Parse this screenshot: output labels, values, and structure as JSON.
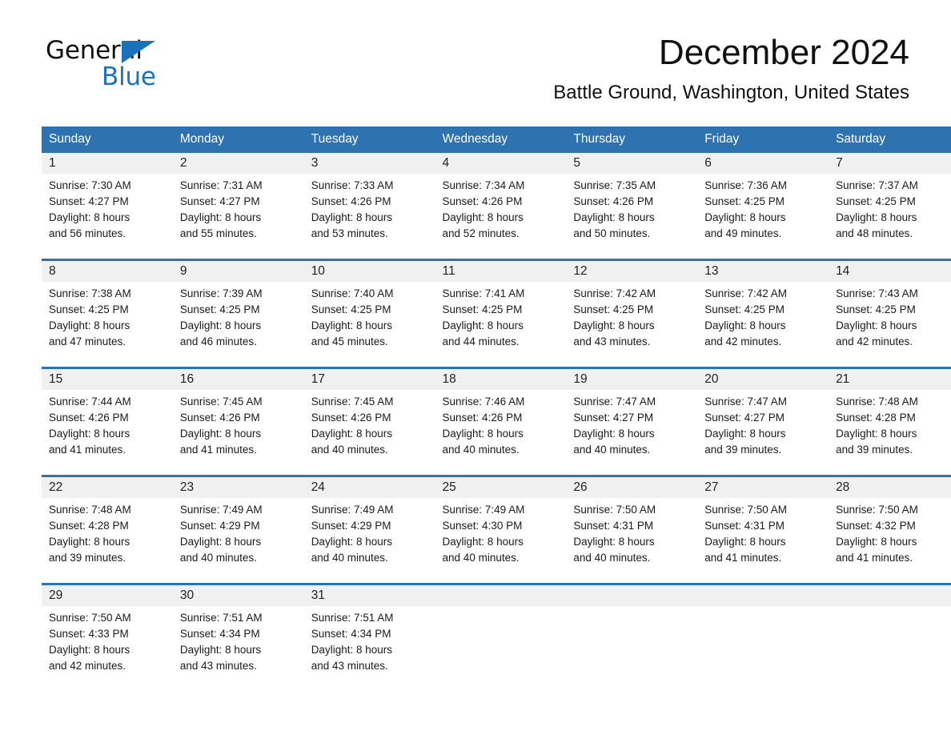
{
  "brand": {
    "name_part1": "General",
    "name_part2": "Blue",
    "accent_color": "#1a72ba"
  },
  "header": {
    "month_title": "December 2024",
    "location": "Battle Ground, Washington, United States"
  },
  "theme": {
    "header_blue": "#2e72b0",
    "day_band_gray": "#f0f0f0"
  },
  "calendar": {
    "weekday_headers": [
      "Sunday",
      "Monday",
      "Tuesday",
      "Wednesday",
      "Thursday",
      "Friday",
      "Saturday"
    ],
    "weeks": [
      [
        {
          "day": "1",
          "sunrise": "Sunrise: 7:30 AM",
          "sunset": "Sunset: 4:27 PM",
          "daylight_line1": "Daylight: 8 hours",
          "daylight_line2": "and 56 minutes."
        },
        {
          "day": "2",
          "sunrise": "Sunrise: 7:31 AM",
          "sunset": "Sunset: 4:27 PM",
          "daylight_line1": "Daylight: 8 hours",
          "daylight_line2": "and 55 minutes."
        },
        {
          "day": "3",
          "sunrise": "Sunrise: 7:33 AM",
          "sunset": "Sunset: 4:26 PM",
          "daylight_line1": "Daylight: 8 hours",
          "daylight_line2": "and 53 minutes."
        },
        {
          "day": "4",
          "sunrise": "Sunrise: 7:34 AM",
          "sunset": "Sunset: 4:26 PM",
          "daylight_line1": "Daylight: 8 hours",
          "daylight_line2": "and 52 minutes."
        },
        {
          "day": "5",
          "sunrise": "Sunrise: 7:35 AM",
          "sunset": "Sunset: 4:26 PM",
          "daylight_line1": "Daylight: 8 hours",
          "daylight_line2": "and 50 minutes."
        },
        {
          "day": "6",
          "sunrise": "Sunrise: 7:36 AM",
          "sunset": "Sunset: 4:25 PM",
          "daylight_line1": "Daylight: 8 hours",
          "daylight_line2": "and 49 minutes."
        },
        {
          "day": "7",
          "sunrise": "Sunrise: 7:37 AM",
          "sunset": "Sunset: 4:25 PM",
          "daylight_line1": "Daylight: 8 hours",
          "daylight_line2": "and 48 minutes."
        }
      ],
      [
        {
          "day": "8",
          "sunrise": "Sunrise: 7:38 AM",
          "sunset": "Sunset: 4:25 PM",
          "daylight_line1": "Daylight: 8 hours",
          "daylight_line2": "and 47 minutes."
        },
        {
          "day": "9",
          "sunrise": "Sunrise: 7:39 AM",
          "sunset": "Sunset: 4:25 PM",
          "daylight_line1": "Daylight: 8 hours",
          "daylight_line2": "and 46 minutes."
        },
        {
          "day": "10",
          "sunrise": "Sunrise: 7:40 AM",
          "sunset": "Sunset: 4:25 PM",
          "daylight_line1": "Daylight: 8 hours",
          "daylight_line2": "and 45 minutes."
        },
        {
          "day": "11",
          "sunrise": "Sunrise: 7:41 AM",
          "sunset": "Sunset: 4:25 PM",
          "daylight_line1": "Daylight: 8 hours",
          "daylight_line2": "and 44 minutes."
        },
        {
          "day": "12",
          "sunrise": "Sunrise: 7:42 AM",
          "sunset": "Sunset: 4:25 PM",
          "daylight_line1": "Daylight: 8 hours",
          "daylight_line2": "and 43 minutes."
        },
        {
          "day": "13",
          "sunrise": "Sunrise: 7:42 AM",
          "sunset": "Sunset: 4:25 PM",
          "daylight_line1": "Daylight: 8 hours",
          "daylight_line2": "and 42 minutes."
        },
        {
          "day": "14",
          "sunrise": "Sunrise: 7:43 AM",
          "sunset": "Sunset: 4:25 PM",
          "daylight_line1": "Daylight: 8 hours",
          "daylight_line2": "and 42 minutes."
        }
      ],
      [
        {
          "day": "15",
          "sunrise": "Sunrise: 7:44 AM",
          "sunset": "Sunset: 4:26 PM",
          "daylight_line1": "Daylight: 8 hours",
          "daylight_line2": "and 41 minutes."
        },
        {
          "day": "16",
          "sunrise": "Sunrise: 7:45 AM",
          "sunset": "Sunset: 4:26 PM",
          "daylight_line1": "Daylight: 8 hours",
          "daylight_line2": "and 41 minutes."
        },
        {
          "day": "17",
          "sunrise": "Sunrise: 7:45 AM",
          "sunset": "Sunset: 4:26 PM",
          "daylight_line1": "Daylight: 8 hours",
          "daylight_line2": "and 40 minutes."
        },
        {
          "day": "18",
          "sunrise": "Sunrise: 7:46 AM",
          "sunset": "Sunset: 4:26 PM",
          "daylight_line1": "Daylight: 8 hours",
          "daylight_line2": "and 40 minutes."
        },
        {
          "day": "19",
          "sunrise": "Sunrise: 7:47 AM",
          "sunset": "Sunset: 4:27 PM",
          "daylight_line1": "Daylight: 8 hours",
          "daylight_line2": "and 40 minutes."
        },
        {
          "day": "20",
          "sunrise": "Sunrise: 7:47 AM",
          "sunset": "Sunset: 4:27 PM",
          "daylight_line1": "Daylight: 8 hours",
          "daylight_line2": "and 39 minutes."
        },
        {
          "day": "21",
          "sunrise": "Sunrise: 7:48 AM",
          "sunset": "Sunset: 4:28 PM",
          "daylight_line1": "Daylight: 8 hours",
          "daylight_line2": "and 39 minutes."
        }
      ],
      [
        {
          "day": "22",
          "sunrise": "Sunrise: 7:48 AM",
          "sunset": "Sunset: 4:28 PM",
          "daylight_line1": "Daylight: 8 hours",
          "daylight_line2": "and 39 minutes."
        },
        {
          "day": "23",
          "sunrise": "Sunrise: 7:49 AM",
          "sunset": "Sunset: 4:29 PM",
          "daylight_line1": "Daylight: 8 hours",
          "daylight_line2": "and 40 minutes."
        },
        {
          "day": "24",
          "sunrise": "Sunrise: 7:49 AM",
          "sunset": "Sunset: 4:29 PM",
          "daylight_line1": "Daylight: 8 hours",
          "daylight_line2": "and 40 minutes."
        },
        {
          "day": "25",
          "sunrise": "Sunrise: 7:49 AM",
          "sunset": "Sunset: 4:30 PM",
          "daylight_line1": "Daylight: 8 hours",
          "daylight_line2": "and 40 minutes."
        },
        {
          "day": "26",
          "sunrise": "Sunrise: 7:50 AM",
          "sunset": "Sunset: 4:31 PM",
          "daylight_line1": "Daylight: 8 hours",
          "daylight_line2": "and 40 minutes."
        },
        {
          "day": "27",
          "sunrise": "Sunrise: 7:50 AM",
          "sunset": "Sunset: 4:31 PM",
          "daylight_line1": "Daylight: 8 hours",
          "daylight_line2": "and 41 minutes."
        },
        {
          "day": "28",
          "sunrise": "Sunrise: 7:50 AM",
          "sunset": "Sunset: 4:32 PM",
          "daylight_line1": "Daylight: 8 hours",
          "daylight_line2": "and 41 minutes."
        }
      ],
      [
        {
          "day": "29",
          "sunrise": "Sunrise: 7:50 AM",
          "sunset": "Sunset: 4:33 PM",
          "daylight_line1": "Daylight: 8 hours",
          "daylight_line2": "and 42 minutes."
        },
        {
          "day": "30",
          "sunrise": "Sunrise: 7:51 AM",
          "sunset": "Sunset: 4:34 PM",
          "daylight_line1": "Daylight: 8 hours",
          "daylight_line2": "and 43 minutes."
        },
        {
          "day": "31",
          "sunrise": "Sunrise: 7:51 AM",
          "sunset": "Sunset: 4:34 PM",
          "daylight_line1": "Daylight: 8 hours",
          "daylight_line2": "and 43 minutes."
        },
        {
          "day": "",
          "sunrise": "",
          "sunset": "",
          "daylight_line1": "",
          "daylight_line2": ""
        },
        {
          "day": "",
          "sunrise": "",
          "sunset": "",
          "daylight_line1": "",
          "daylight_line2": ""
        },
        {
          "day": "",
          "sunrise": "",
          "sunset": "",
          "daylight_line1": "",
          "daylight_line2": ""
        },
        {
          "day": "",
          "sunrise": "",
          "sunset": "",
          "daylight_line1": "",
          "daylight_line2": ""
        }
      ]
    ]
  }
}
